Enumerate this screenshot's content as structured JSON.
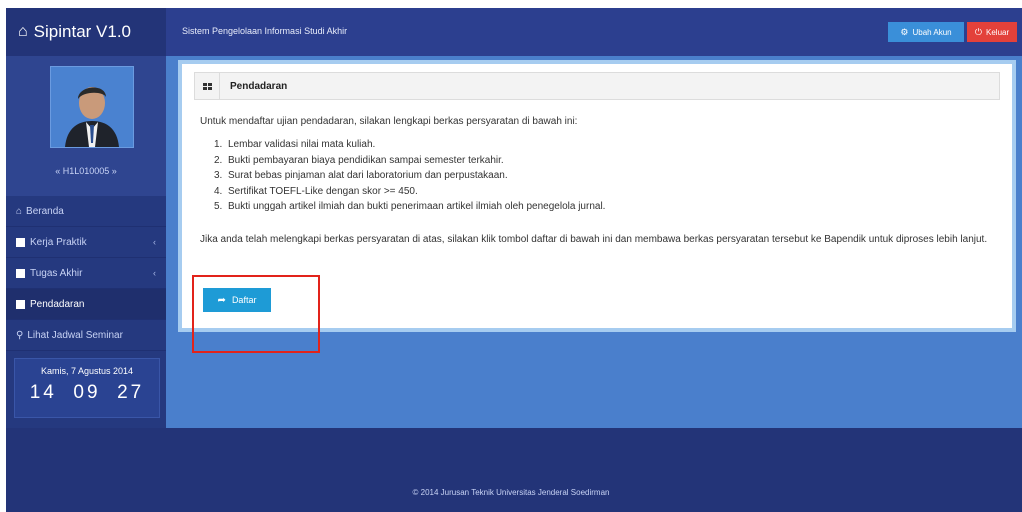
{
  "app": {
    "title": "Sipintar V1.0",
    "subtitle": "Sistem Pengelolaan Informasi Studi Akhir"
  },
  "top_buttons": {
    "akun": "Ubah Akun",
    "keluar": "Keluar"
  },
  "user": {
    "name": "« H1L010005 »"
  },
  "sidebar": {
    "items": [
      {
        "label": "Beranda"
      },
      {
        "label": "Kerja Praktik"
      },
      {
        "label": "Tugas Akhir"
      },
      {
        "label": "Pendadaran"
      },
      {
        "label": "Lihat Jadwal Seminar"
      }
    ]
  },
  "clock": {
    "date": "Kamis, 7 Agustus 2014",
    "time": "14  09  27"
  },
  "panel": {
    "title": "Pendadaran",
    "intro": "Untuk mendaftar ujian pendadaran, silakan lengkapi berkas persyaratan di bawah ini:",
    "requirements": [
      "Lembar validasi nilai mata kuliah.",
      "Bukti pembayaran biaya pendidikan sampai semester terkahir.",
      "Surat bebas pinjaman alat dari laboratorium dan perpustakaan.",
      "Sertifikat TOEFL-Like dengan skor >= 450.",
      "Bukti unggah artikel ilmiah dan bukti penerimaan artikel ilmiah oleh penegelola jurnal."
    ],
    "note": "Jika anda telah melengkapi berkas persyaratan di atas, silakan klik tombol daftar di bawah ini dan membawa berkas persyaratan tersebut ke Bapendik untuk diproses lebih lanjut.",
    "button": "Daftar"
  },
  "footer": {
    "text": "© 2014 Jurusan Teknik Universitas Jenderal Soedirman"
  },
  "colors": {
    "header": "#2c3f8f",
    "main": "#4a7fcc",
    "button": "#1e9bd6",
    "highlight": "#e2231a"
  }
}
